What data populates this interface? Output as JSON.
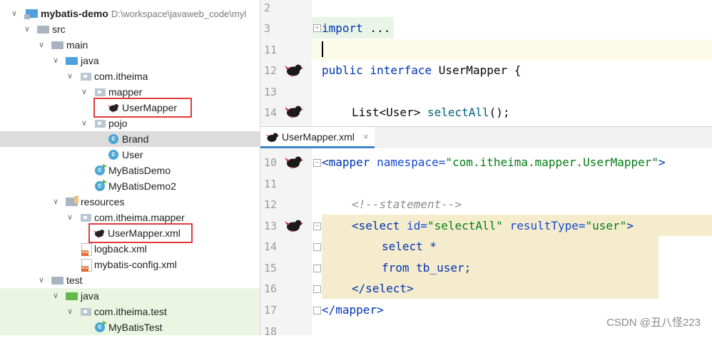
{
  "tree": {
    "project_name": "mybatis-demo",
    "project_path": "D:\\workspace\\javaweb_code\\myl",
    "items": [
      {
        "label": "src"
      },
      {
        "label": "main"
      },
      {
        "label": "java"
      },
      {
        "label": "com.itheima"
      },
      {
        "label": "mapper"
      },
      {
        "label": "UserMapper"
      },
      {
        "label": "pojo"
      },
      {
        "label": "Brand"
      },
      {
        "label": "User"
      },
      {
        "label": "MyBatisDemo"
      },
      {
        "label": "MyBatisDemo2"
      },
      {
        "label": "resources"
      },
      {
        "label": "com.itheima.mapper"
      },
      {
        "label": "UserMapper.xml"
      },
      {
        "label": "logback.xml"
      },
      {
        "label": "mybatis-config.xml"
      },
      {
        "label": "test"
      },
      {
        "label": "java"
      },
      {
        "label": "com.itheima.test"
      },
      {
        "label": "MyBatisTest"
      }
    ],
    "class_icon_letter": "c"
  },
  "java_editor": {
    "line_numbers": [
      "2",
      "3",
      "11",
      "12",
      "13",
      "14"
    ],
    "import_kw": "import",
    "import_rest": " ...",
    "public_kw": "public",
    "interface_kw": "interface",
    "class_name": " UserMapper {",
    "select_prefix": "List<User> ",
    "select_method": "selectAll",
    "select_suffix": "();"
  },
  "xml_tab": {
    "label": "UserMapper.xml",
    "close": "×"
  },
  "xml_editor": {
    "line_numbers": [
      "10",
      "11",
      "12",
      "13",
      "14",
      "15",
      "16",
      "17",
      "18"
    ],
    "mapper_open_tag": "<mapper",
    "namespace_attr": " namespace=",
    "namespace_value": "\"com.itheima.mapper.UserMapper\"",
    "mapper_open_end": ">",
    "comment": "<!--statement-->",
    "select_open_tag": "<select",
    "id_attr": " id=",
    "id_value": "\"selectAll\"",
    "result_attr": " resultType=",
    "result_value": "\"user\"",
    "select_open_end": ">",
    "sql_line1": "select *",
    "sql_line2": "from tb_user;",
    "select_close": "</select>",
    "mapper_close": "</mapper>"
  },
  "watermark": "CSDN @丑八怪223",
  "colors": {
    "highlight_box": "#e23a3a",
    "code_block": "#f5eccd",
    "caret_line": "#fcfae9"
  }
}
